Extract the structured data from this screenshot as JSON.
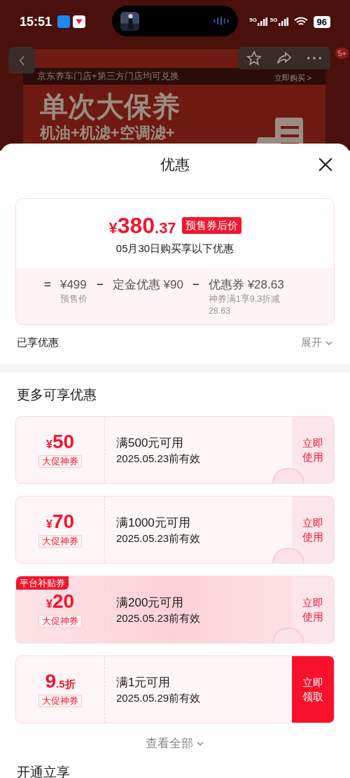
{
  "status_bar": {
    "time": "15:51",
    "network_1": "5G",
    "network_2": "5G",
    "battery": "96"
  },
  "background_page": {
    "badge": "5+",
    "banner_strip": "京东养车门店+第三方门店均可兑换",
    "banner_link": "立即购买 >",
    "banner_title": "单次大保养",
    "banner_subtitle": "机油+机滤+空调滤+"
  },
  "sheet": {
    "title": "优惠",
    "summary": {
      "currency": "¥",
      "price_integer": "380",
      "price_decimal": ".37",
      "price_tag": "预售券后价",
      "subtitle": "05月30日购买享以下优惠",
      "formula": [
        {
          "kind": "operator",
          "text": "="
        },
        {
          "kind": "term",
          "text": "¥499",
          "note": "预售价"
        },
        {
          "kind": "operator",
          "text": "−"
        },
        {
          "kind": "term",
          "text": "定金优惠 ¥90"
        },
        {
          "kind": "operator",
          "text": "−"
        },
        {
          "kind": "term",
          "text": "优惠券 ¥28.63",
          "note": "神券满1享9.3折减28.63"
        }
      ]
    },
    "enjoyed": {
      "label": "已享优惠",
      "toggle": "展开",
      "expanded": false
    },
    "more_title": "更多可享优惠",
    "coupons": [
      {
        "prefix": "¥",
        "amount": "50",
        "tag": "大促神券",
        "condition": "满500元可用",
        "validity": "2025.05.23前有效",
        "action": "立即使用",
        "kind": "use",
        "featured": false,
        "claimed": true
      },
      {
        "prefix": "¥",
        "amount": "70",
        "tag": "大促神券",
        "condition": "满1000元可用",
        "validity": "2025.05.23前有效",
        "action": "立即使用",
        "kind": "use",
        "featured": false,
        "claimed": true
      },
      {
        "prefix": "¥",
        "amount": "20",
        "tag": "大促神券",
        "condition": "满200元可用",
        "validity": "2025.05.23前有效",
        "action": "立即使用",
        "kind": "use",
        "featured": true,
        "ribbon": "平台补贴券",
        "claimed": true
      },
      {
        "amount": "9",
        "suffix": ".5折",
        "tag": "大促神券",
        "condition": "满1元可用",
        "validity": "2025.05.29前有效",
        "action": "立即领取",
        "kind": "claim",
        "featured": false,
        "claimed": false
      }
    ],
    "view_all": "查看全部",
    "next_title": "开通立享"
  }
}
